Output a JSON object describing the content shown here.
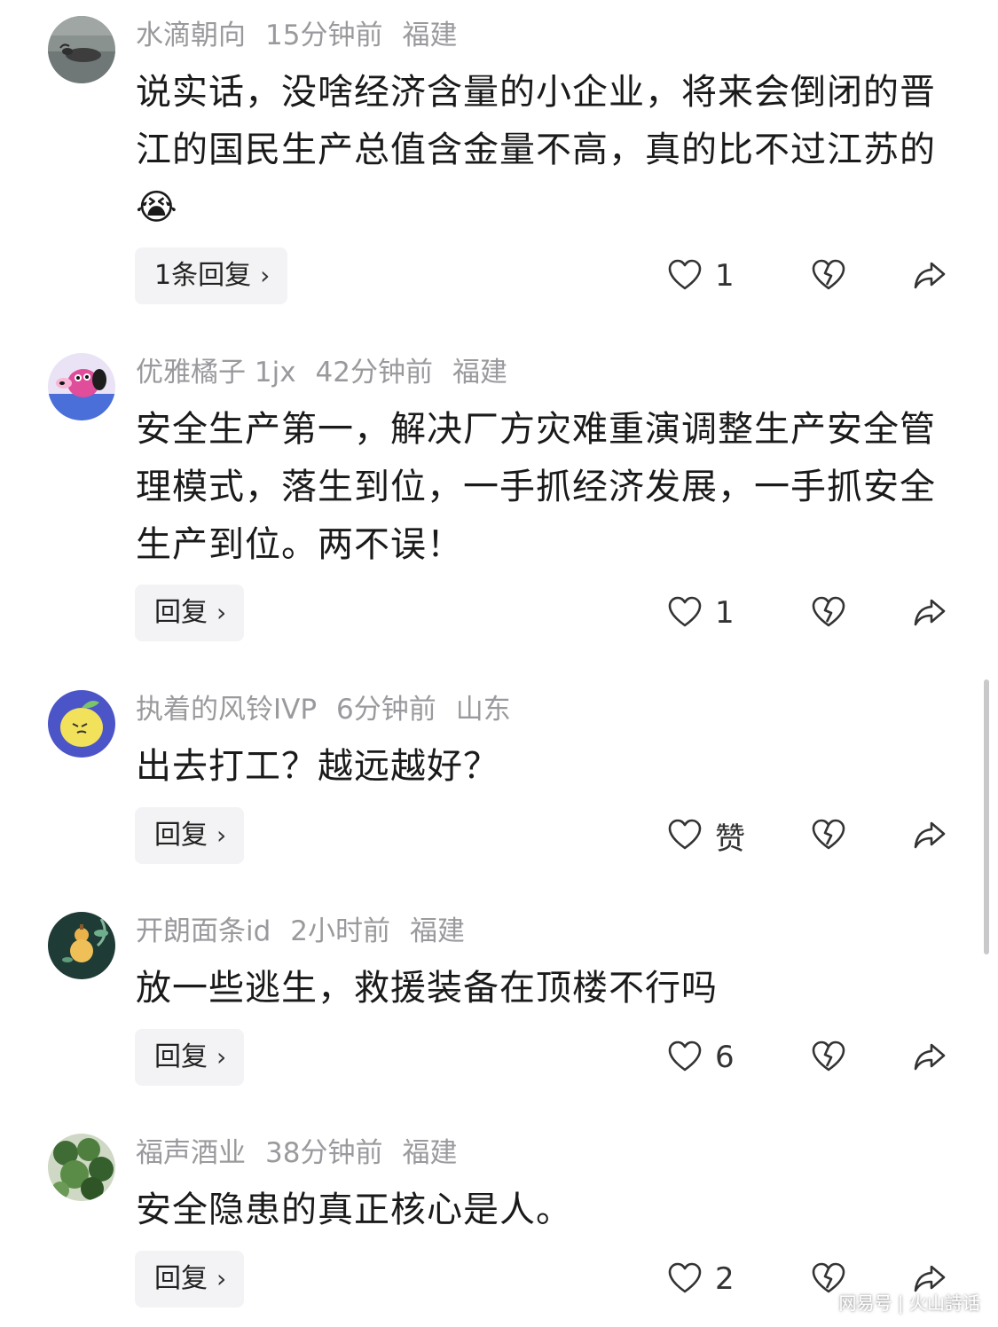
{
  "comments": [
    {
      "username": "水滴朝向",
      "time": "15分钟前",
      "location": "福建",
      "text": "说实话，没啥经济含量的小企业，将来会倒闭的晋江的国民生产总值含金量不高，真的比不过江苏的😭",
      "reply_label": "1条回复",
      "like_count": "1",
      "avatar": "water-buffalo-avatar"
    },
    {
      "username": "优雅橘子 1jx",
      "time": "42分钟前",
      "location": "福建",
      "text": "安全生产第一，解决厂方灾难重演调整生产安全管理模式，落生到位，一手抓经济发展，一手抓安全生产到位。两不误！",
      "reply_label": "回复",
      "like_count": "1",
      "avatar": "cartoon-dog-avatar"
    },
    {
      "username": "执着的风铃IVP",
      "time": "6分钟前",
      "location": "山东",
      "text": "出去打工？越远越好？",
      "reply_label": "回复",
      "like_count": "赞",
      "avatar": "lemon-avatar"
    },
    {
      "username": "开朗面条id",
      "time": "2小时前",
      "location": "福建",
      "text": "放一些逃生，救援装备在顶楼不行吗",
      "reply_label": "回复",
      "like_count": "6",
      "avatar": "gourd-avatar"
    },
    {
      "username": "福声酒业",
      "time": "38分钟前",
      "location": "福建",
      "text": "安全隐患的真正核心是人。",
      "reply_label": "回复",
      "like_count": "2",
      "avatar": "green-leaves-avatar"
    }
  ],
  "icons": {
    "reply_chevron": "chevron-right-icon",
    "like": "heart-outline-icon",
    "dislike": "broken-heart-icon",
    "share": "share-arrow-icon"
  },
  "colors": {
    "meta_text": "#9a9a9e",
    "reply_button_bg": "#f3f3f5",
    "body_text": "#1a1a1a"
  },
  "watermark": "网易号 | 火山詩话"
}
